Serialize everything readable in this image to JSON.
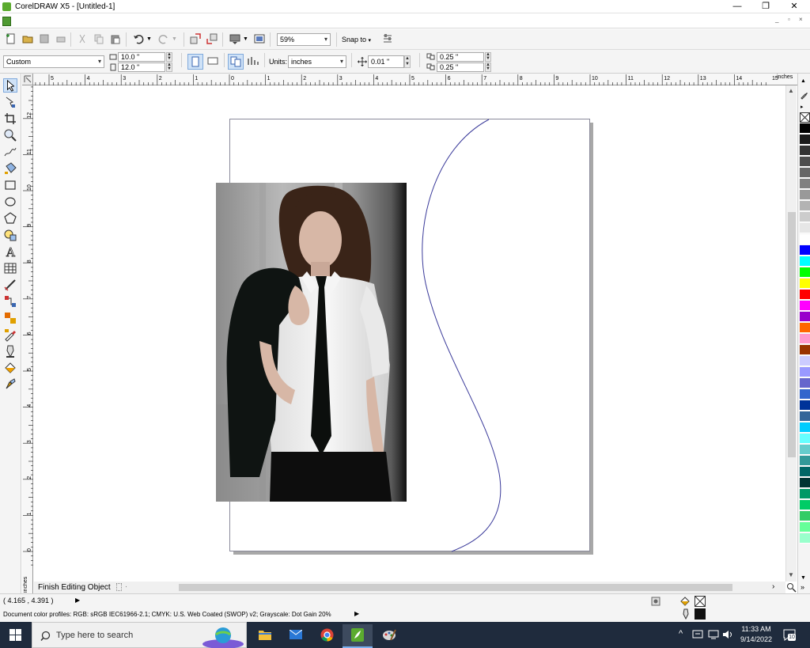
{
  "window": {
    "title": "CorelDRAW X5 - [Untitled-1]",
    "controls": {
      "minimize": "—",
      "restore": "❐",
      "close": "✕"
    }
  },
  "toolbar": {
    "zoom_value": "59%",
    "snap_to_label": "Snap to"
  },
  "property_bar": {
    "page_size_preset": "Custom",
    "page_width": "10.0 \"",
    "page_height": "12.0 \"",
    "units_label": "Units:",
    "units_value": "inches",
    "nudge_value": "0.01 \"",
    "duplicate_x": "0.25 \"",
    "duplicate_y": "0.25 \""
  },
  "ruler": {
    "h_labels": [
      "5",
      "4",
      "3",
      "2",
      "1",
      "0",
      "1",
      "2",
      "3",
      "4",
      "5",
      "6",
      "7",
      "8",
      "9",
      "10",
      "11",
      "12",
      "13",
      "14",
      "15"
    ],
    "units": "inches",
    "v_labels": [
      "12",
      "11",
      "10",
      "9",
      "8",
      "7",
      "6",
      "5",
      "4",
      "3",
      "2",
      "1",
      "0"
    ],
    "v_units": "inches"
  },
  "canvas": {
    "tab_label": "Finish Editing Object"
  },
  "status": {
    "coords": "( 4.165 , 4.391 )",
    "color_profiles": "Document color profiles: RGB: sRGB IEC61966-2.1; CMYK: U.S. Web Coated (SWOP) v2; Grayscale: Dot Gain 20%"
  },
  "taskbar": {
    "search_placeholder": "Type here to search",
    "time": "11:33 AM",
    "date": "9/14/2022",
    "notification_count": "10"
  },
  "palette": {
    "colors": [
      "#000000",
      "#1a1a1a",
      "#333333",
      "#4d4d4d",
      "#666666",
      "#808080",
      "#999999",
      "#b3b3b3",
      "#cccccc",
      "#e6e6e6",
      "#ffffff",
      "#0000ff",
      "#00ffff",
      "#00ff00",
      "#ffff00",
      "#ff0000",
      "#ff00ff",
      "#9900cc",
      "#ff6600",
      "#ff99cc",
      "#993300",
      "#ccccff",
      "#9999ff",
      "#6666cc",
      "#3366cc",
      "#003399",
      "#336699",
      "#00ccff",
      "#66ffff",
      "#66cccc",
      "#339999",
      "#006666",
      "#003333",
      "#009966",
      "#00cc66",
      "#33cc66",
      "#66ff99",
      "#99ffcc"
    ]
  }
}
